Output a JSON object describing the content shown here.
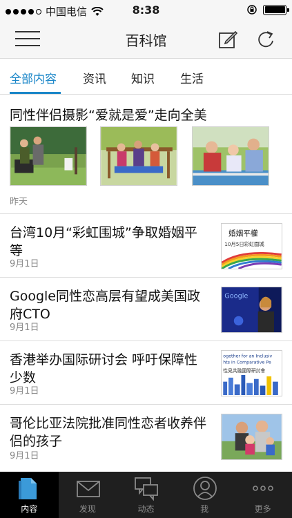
{
  "status_bar": {
    "carrier": "中国电信",
    "time": "8:38"
  },
  "navbar": {
    "title": "百科馆"
  },
  "tabs": [
    {
      "label": "全部内容",
      "active": true
    },
    {
      "label": "资讯"
    },
    {
      "label": "知识"
    },
    {
      "label": "生活"
    }
  ],
  "featured": {
    "headline": "同性伴侣摄影“爱就是爱”走向全美",
    "date": "昨天"
  },
  "articles": [
    {
      "headline": "台湾10月“彩虹围城”争取婚姻平等",
      "date": "9月1日",
      "thumb_text_1": "婚姻平權",
      "thumb_text_2": "10月5日彩虹圍城"
    },
    {
      "headline": "Google同性恋高层有望成美国政府CTO",
      "date": "9月1日",
      "thumb_text_1": "Google"
    },
    {
      "headline": "香港举办国际研讨会 呼吁保障性少数",
      "date": "9月1日",
      "thumb_text_1": "ogether for an Inclusiv",
      "thumb_text_2": "hts in Comparative Pe",
      "thumb_text_3": "性見共融國際研討會"
    },
    {
      "headline": "哥伦比亚法院批准同性恋者收养伴侣的孩子",
      "date": "9月1日"
    }
  ],
  "tabbar": [
    {
      "label": "内容",
      "icon": "document-icon",
      "active": true
    },
    {
      "label": "发现",
      "icon": "envelope-icon"
    },
    {
      "label": "动态",
      "icon": "chat-bubbles-icon"
    },
    {
      "label": "我",
      "icon": "user-icon"
    },
    {
      "label": "更多",
      "icon": "more-dots-icon"
    }
  ],
  "colors": {
    "accent": "#1a86c8",
    "tabbar_bg": "#1f1f1f",
    "navbar_bg": "#f6f6f6"
  }
}
